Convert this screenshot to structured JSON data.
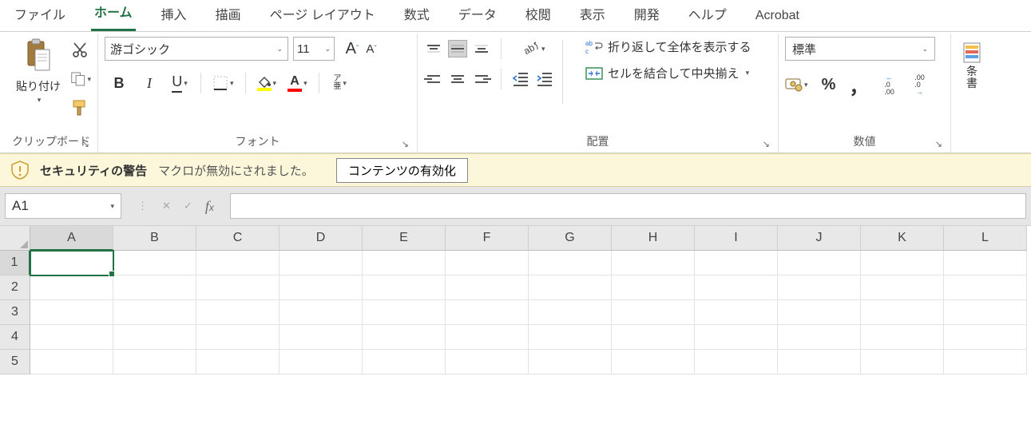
{
  "tabs": {
    "file": "ファイル",
    "home": "ホーム",
    "insert": "挿入",
    "draw": "描画",
    "layout": "ページ レイアウト",
    "formulas": "数式",
    "data": "データ",
    "review": "校閲",
    "view": "表示",
    "developer": "開発",
    "help": "ヘルプ",
    "acrobat": "Acrobat"
  },
  "ribbon": {
    "clipboard": {
      "label": "クリップボード",
      "paste": "貼り付け"
    },
    "font": {
      "label": "フォント",
      "name": "游ゴシック",
      "size": "11",
      "grow": "A",
      "shrink": "A",
      "bold": "B",
      "italic": "I",
      "underline": "U",
      "phonetic": "ア\n亜"
    },
    "alignment": {
      "label": "配置",
      "wrap": "折り返して全体を表示する",
      "merge": "セルを結合して中央揃え"
    },
    "number": {
      "label": "数値",
      "format": "標準",
      "percent": "%",
      "comma": "，",
      "inc": ".0\n.00",
      "dec": ".00\n.0"
    },
    "styles": {
      "cond": "条\n書"
    }
  },
  "security": {
    "title": "セキュリティの警告",
    "message": "マクロが無効にされました。",
    "button": "コンテンツの有効化"
  },
  "formula_bar": {
    "name_box": "A1"
  },
  "grid": {
    "columns": [
      "A",
      "B",
      "C",
      "D",
      "E",
      "F",
      "G",
      "H",
      "I",
      "J",
      "K",
      "L"
    ],
    "rows": [
      "1",
      "2",
      "3",
      "4",
      "5"
    ],
    "active_cell": "A1"
  }
}
